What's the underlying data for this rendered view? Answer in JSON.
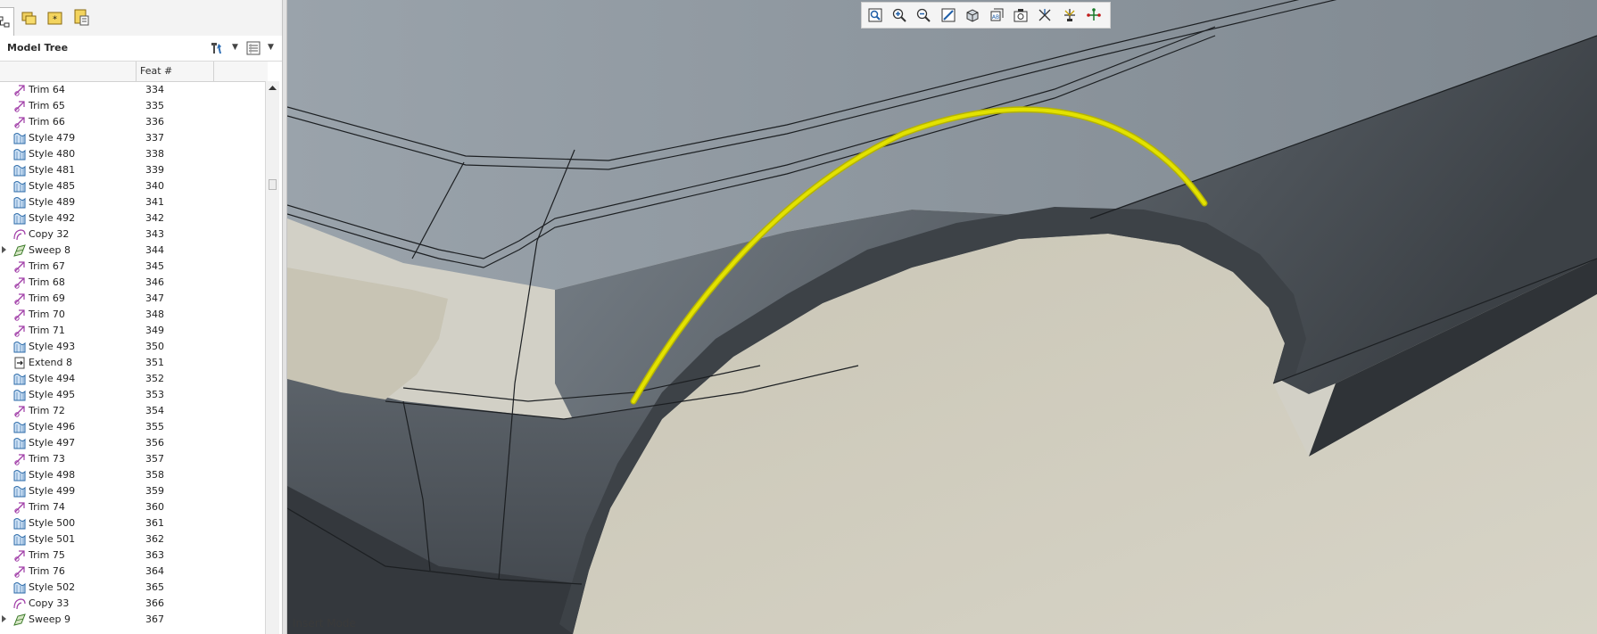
{
  "left_panel": {
    "tabs": [
      {
        "icon": "model-tree-tab-icon",
        "active": true
      },
      {
        "icon": "folder-browser-icon",
        "active": false
      },
      {
        "icon": "favorites-icon",
        "active": false
      },
      {
        "icon": "layers-icon",
        "active": false
      }
    ],
    "title": "Model Tree",
    "settings_icon": "tree-settings-icon",
    "columns_icon": "tree-columns-icon",
    "columns": {
      "feat": "Feat #"
    },
    "rows": [
      {
        "name": "Trim 64",
        "feat": "334",
        "type": "trim",
        "expandable": false
      },
      {
        "name": "Trim 65",
        "feat": "335",
        "type": "trim",
        "expandable": false
      },
      {
        "name": "Trim 66",
        "feat": "336",
        "type": "trim",
        "expandable": false
      },
      {
        "name": "Style 479",
        "feat": "337",
        "type": "style",
        "expandable": false
      },
      {
        "name": "Style 480",
        "feat": "338",
        "type": "style",
        "expandable": false
      },
      {
        "name": "Style 481",
        "feat": "339",
        "type": "style",
        "expandable": false
      },
      {
        "name": "Style 485",
        "feat": "340",
        "type": "style",
        "expandable": false
      },
      {
        "name": "Style 489",
        "feat": "341",
        "type": "style",
        "expandable": false
      },
      {
        "name": "Style 492",
        "feat": "342",
        "type": "style",
        "expandable": false
      },
      {
        "name": "Copy 32",
        "feat": "343",
        "type": "copy",
        "expandable": false
      },
      {
        "name": "Sweep 8",
        "feat": "344",
        "type": "sweep",
        "expandable": true
      },
      {
        "name": "Trim 67",
        "feat": "345",
        "type": "trim",
        "expandable": false
      },
      {
        "name": "Trim 68",
        "feat": "346",
        "type": "trim",
        "expandable": false
      },
      {
        "name": "Trim 69",
        "feat": "347",
        "type": "trim",
        "expandable": false
      },
      {
        "name": "Trim 70",
        "feat": "348",
        "type": "trim",
        "expandable": false
      },
      {
        "name": "Trim 71",
        "feat": "349",
        "type": "trim",
        "expandable": false
      },
      {
        "name": "Style 493",
        "feat": "350",
        "type": "style",
        "expandable": false
      },
      {
        "name": "Extend 8",
        "feat": "351",
        "type": "extend",
        "expandable": false
      },
      {
        "name": "Style 494",
        "feat": "352",
        "type": "style",
        "expandable": false
      },
      {
        "name": "Style 495",
        "feat": "353",
        "type": "style",
        "expandable": false
      },
      {
        "name": "Trim 72",
        "feat": "354",
        "type": "trim",
        "expandable": false
      },
      {
        "name": "Style 496",
        "feat": "355",
        "type": "style",
        "expandable": false
      },
      {
        "name": "Style 497",
        "feat": "356",
        "type": "style",
        "expandable": false
      },
      {
        "name": "Trim 73",
        "feat": "357",
        "type": "trim",
        "expandable": false
      },
      {
        "name": "Style 498",
        "feat": "358",
        "type": "style",
        "expandable": false
      },
      {
        "name": "Style 499",
        "feat": "359",
        "type": "style",
        "expandable": false
      },
      {
        "name": "Trim 74",
        "feat": "360",
        "type": "trim",
        "expandable": false
      },
      {
        "name": "Style 500",
        "feat": "361",
        "type": "style",
        "expandable": false
      },
      {
        "name": "Style 501",
        "feat": "362",
        "type": "style",
        "expandable": false
      },
      {
        "name": "Trim 75",
        "feat": "363",
        "type": "trim",
        "expandable": false
      },
      {
        "name": "Trim 76",
        "feat": "364",
        "type": "trim",
        "expandable": false
      },
      {
        "name": "Style 502",
        "feat": "365",
        "type": "style",
        "expandable": false
      },
      {
        "name": "Copy 33",
        "feat": "366",
        "type": "copy",
        "expandable": false
      },
      {
        "name": "Sweep 9",
        "feat": "367",
        "type": "sweep",
        "expandable": true
      }
    ]
  },
  "view_toolbar": {
    "buttons": [
      "refit-icon",
      "zoom-in-icon",
      "zoom-out-icon",
      "repaint-icon",
      "display-style-icon",
      "saved-orientations-icon",
      "view-manager-icon",
      "datum-display-icon",
      "spin-center-icon",
      "annotation-display-icon"
    ]
  },
  "status": {
    "mode": "Insert Mode"
  },
  "colors": {
    "viewport_bg": "#d2d0c6",
    "surface_dark": "#4a4f55",
    "surface_light": "#8b949c",
    "highlight_curve": "#d9d900"
  }
}
